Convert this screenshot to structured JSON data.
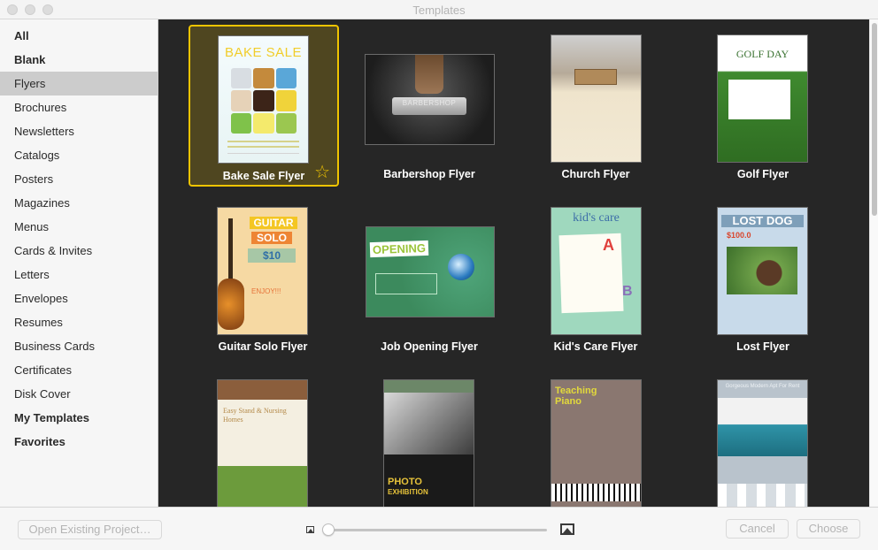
{
  "window": {
    "title": "Templates"
  },
  "sidebar": {
    "items": [
      {
        "label": "All",
        "bold": true
      },
      {
        "label": "Blank",
        "bold": true
      },
      {
        "label": "Flyers",
        "bold": false,
        "selected": true
      },
      {
        "label": "Brochures"
      },
      {
        "label": "Newsletters"
      },
      {
        "label": "Catalogs"
      },
      {
        "label": "Posters"
      },
      {
        "label": "Magazines"
      },
      {
        "label": "Menus"
      },
      {
        "label": "Cards & Invites"
      },
      {
        "label": "Letters"
      },
      {
        "label": "Envelopes"
      },
      {
        "label": "Resumes"
      },
      {
        "label": "Business Cards"
      },
      {
        "label": "Certificates"
      },
      {
        "label": "Disk Cover"
      },
      {
        "label": "My Templates",
        "bold": true
      },
      {
        "label": "Favorites",
        "bold": true
      }
    ]
  },
  "templates": [
    {
      "label": "Bake Sale Flyer",
      "selected": true,
      "favorite_icon": "star-outline-icon",
      "thumb_text": "BAKE SALE"
    },
    {
      "label": "Barbershop Flyer",
      "thumb_text": "BARBERSHOP"
    },
    {
      "label": "Church Flyer"
    },
    {
      "label": "Golf Flyer",
      "thumb_text": "GOLF DAY"
    },
    {
      "label": "Guitar Solo Flyer",
      "thumb_text": [
        "GUITAR",
        "SOLO",
        "$10",
        "ENJOY!!!"
      ]
    },
    {
      "label": "Job Opening Flyer",
      "thumb_text": "OPENING"
    },
    {
      "label": "Kid's Care Flyer",
      "thumb_text": [
        "kid's care",
        "A",
        "B"
      ]
    },
    {
      "label": "Lost Flyer",
      "thumb_text": [
        "LOST DOG",
        "$100.0"
      ]
    },
    {
      "label": "",
      "thumb_text": "Easy Stand & Nursing Homes"
    },
    {
      "label": "",
      "thumb_text": [
        "PHOTO",
        "EXHIBITION"
      ]
    },
    {
      "label": "",
      "thumb_text": [
        "Teaching",
        "Piano"
      ]
    },
    {
      "label": "",
      "thumb_text": "Gorgeous Modern Apt For Rent"
    }
  ],
  "colors": {
    "accent_selection": "#f0c400",
    "grid_background": "#262626",
    "sidebar_selected": "#cccccc"
  },
  "footer": {
    "open_existing": "Open Existing Project…",
    "cancel": "Cancel",
    "choose": "Choose",
    "zoom_slider_value": 0
  }
}
